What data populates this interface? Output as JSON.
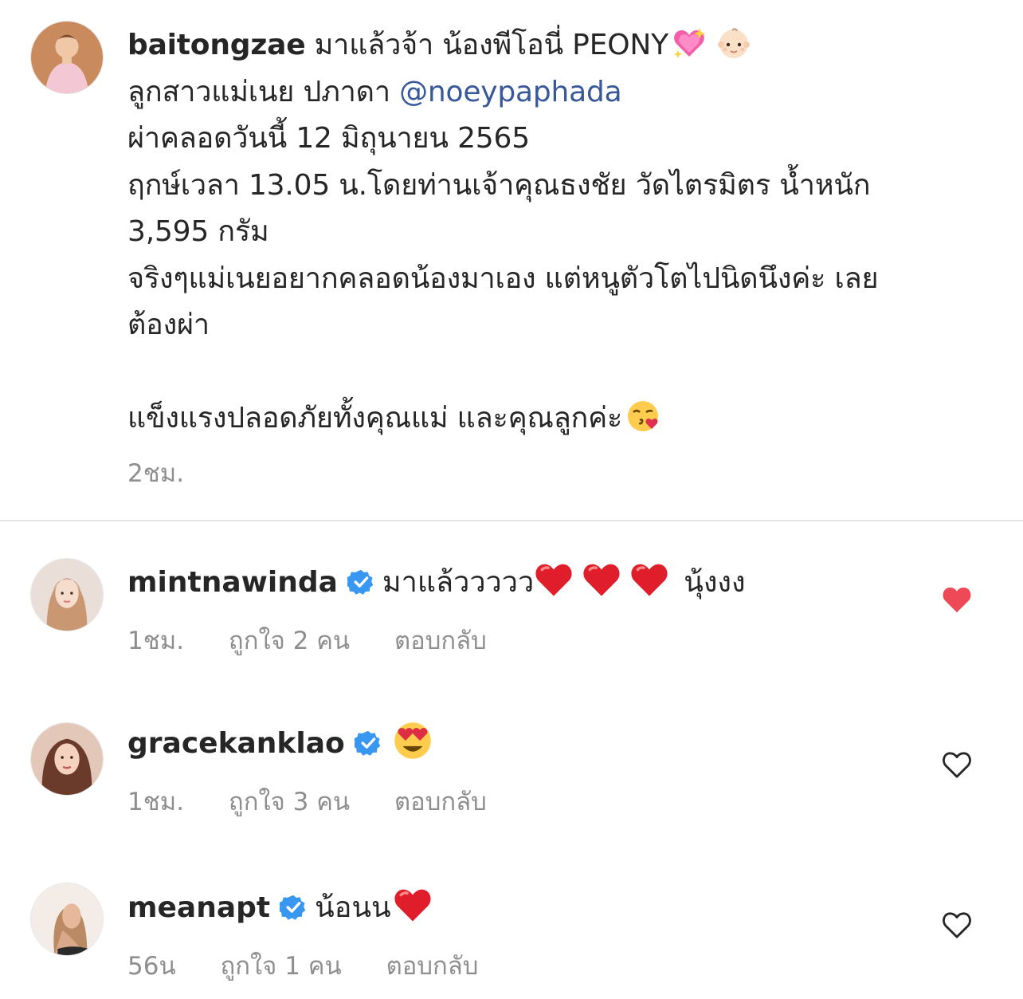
{
  "post": {
    "username": "baitongzae",
    "lines": {
      "l1_text": "มาแล้วจ้า น้องพีโอนี่ PEONY",
      "l2_text": "ลูกสาวแม่เนย ปภาดา ",
      "l2_mention": "@noeypaphada",
      "l3": "ผ่าคลอดวันนี้ 12 มิถุนายน 2565",
      "l4": "ฤกษ์เวลา 13.05 น.โดยท่านเจ้าคุณธงชัย วัดไตรมิตร น้ำหนัก",
      "l5": "3,595 กรัม",
      "l6": "จริงๆแม่เนยอยากคลอดน้องมาเอง แต่หนูตัวโตไปนิดนึงค่ะ เลย",
      "l7": "ต้องผ่า",
      "l8": "แข็งแรงปลอดภัยทั้งคุณแม่ และคุณลูกค่ะ"
    },
    "time": "2ชม."
  },
  "comments": [
    {
      "username": "mintnawinda",
      "text": "มาแล้ววววว",
      "text_after": "นุ้งงง",
      "time": "1ชม.",
      "likes": "ถูกใจ 2 คน",
      "reply": "ตอบกลับ",
      "liked": true
    },
    {
      "username": "gracekanklao",
      "text": "",
      "time": "1ชม.",
      "likes": "ถูกใจ 3 คน",
      "reply": "ตอบกลับ",
      "liked": false
    },
    {
      "username": "meanapt",
      "text": "น้อนน",
      "time": "56น",
      "likes": "ถูกใจ 1 คน",
      "reply": "ตอบกลับ",
      "liked": false
    }
  ],
  "icons": {
    "verified_badge": "verified-badge-icon",
    "like_filled": "heart-filled-icon",
    "like_outline": "heart-outline-icon"
  },
  "colors": {
    "text": "#262626",
    "secondary": "#8e8e8e",
    "mention": "#385898",
    "verified": "#3897f0",
    "like_red": "#ed4956"
  }
}
